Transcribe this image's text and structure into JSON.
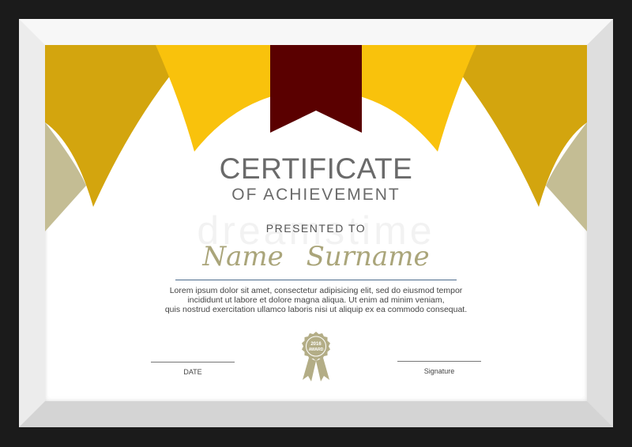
{
  "certificate": {
    "title": "CERTIFICATE",
    "subtitle": "OF ACHIEVEMENT",
    "presented_to": "PRESENTED TO",
    "recipient_name": "Name  Surname",
    "body_lines": [
      "Lorem ipsum dolor sit amet, consectetur adipisicing elit, sed do eiusmod tempor",
      "incididunt ut labore et dolore magna aliqua. Ut enim ad minim veniam,",
      "quis nostrud exercitation ullamco laboris nisi ut aliquip ex ea commodo consequat."
    ],
    "date_label": "DATE",
    "signature_label": "Signature",
    "seal": {
      "year": "2016",
      "text": "AWARD"
    },
    "watermark": "dreamstime"
  },
  "colors": {
    "background": "#1b1b1b",
    "gold_dark": "#d3a50e",
    "gold_light": "#f9c20c",
    "khaki": "#c4bd94",
    "ribbon": "#5a0000",
    "seal": "#b3ad86"
  }
}
